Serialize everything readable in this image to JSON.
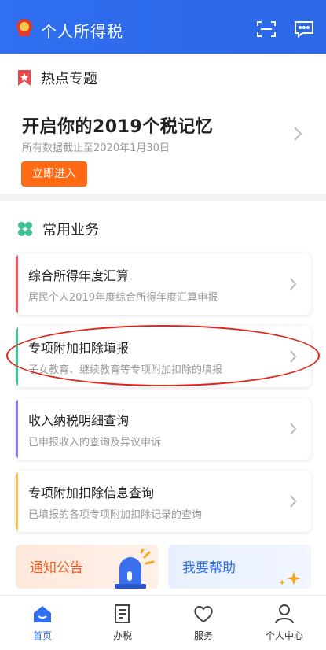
{
  "header": {
    "title": "个人所得税",
    "emblem_icon": "tax-emblem-icon",
    "scan_icon": "scan-icon",
    "message_icon": "message-icon",
    "color": "#2f6ff0"
  },
  "hot_topics": {
    "section_title": "热点专题",
    "promo_title": "开启你的2019个税记忆",
    "promo_subtitle": "所有数据截止至2020年1月30日",
    "promo_button": "立即进入",
    "button_color": "#ff6a12"
  },
  "common_business": {
    "section_title": "常用业务",
    "items": [
      {
        "title": "综合所得年度汇算",
        "subtitle": "居民个人2019年度综合所得年度汇算申报",
        "accent": "#f05a67"
      },
      {
        "title": "专项附加扣除填报",
        "subtitle": "子女教育、继续教育等专项附加扣除的填报",
        "accent": "#43c29a"
      },
      {
        "title": "收入纳税明细查询",
        "subtitle": "已申报收入的查询及异议申诉",
        "accent": "#8e7cf0"
      },
      {
        "title": "专项附加扣除信息查询",
        "subtitle": "已填报的各项专项附加扣除记录的查询",
        "accent": "#f4c24a"
      }
    ]
  },
  "tiles": {
    "notice": "通知公告",
    "help": "我要帮助"
  },
  "tabbar": {
    "items": [
      {
        "label": "首页",
        "icon": "home-icon",
        "active": true
      },
      {
        "label": "办税",
        "icon": "tax-form-icon",
        "active": false
      },
      {
        "label": "服务",
        "icon": "service-heart-icon",
        "active": false
      },
      {
        "label": "个人中心",
        "icon": "profile-icon",
        "active": false
      }
    ]
  }
}
